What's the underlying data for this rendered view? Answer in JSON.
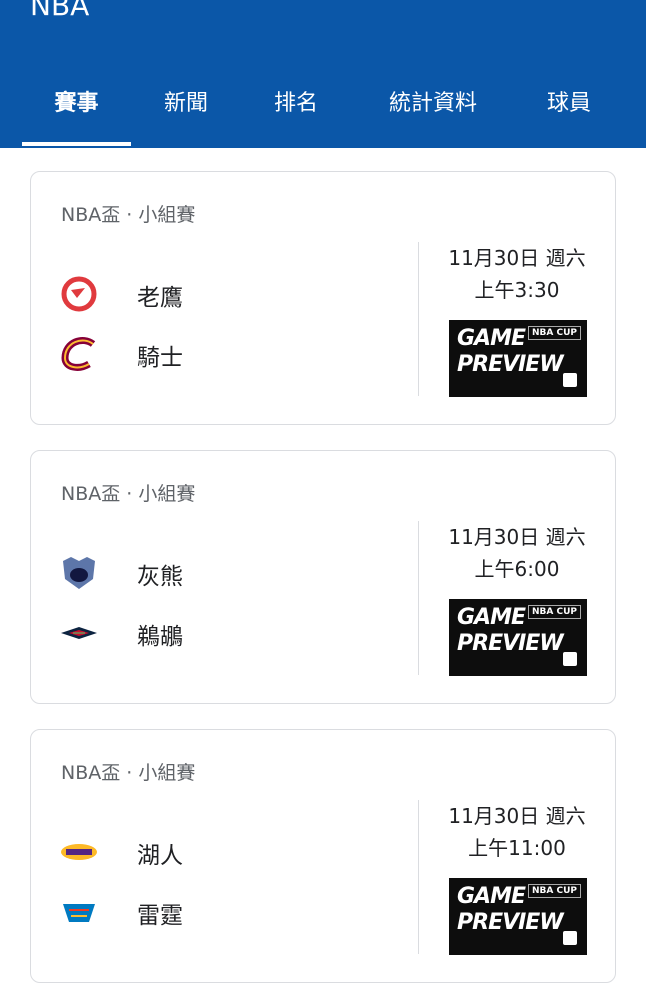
{
  "app": {
    "title": "NBA"
  },
  "tabs": [
    {
      "label": "賽事"
    },
    {
      "label": "新聞"
    },
    {
      "label": "排名"
    },
    {
      "label": "統計資料"
    },
    {
      "label": "球員"
    }
  ],
  "games": [
    {
      "competition": "NBA盃 · 小組賽",
      "teams": [
        {
          "name": "老鷹",
          "logo": "hawks-logo-icon"
        },
        {
          "name": "騎士",
          "logo": "cavaliers-logo-icon"
        }
      ],
      "date": "11月30日 週六",
      "time": "上午3:30",
      "preview": {
        "line1": "GAME",
        "line2": "PREVIEW",
        "badge": "NBA CUP"
      }
    },
    {
      "competition": "NBA盃 · 小組賽",
      "teams": [
        {
          "name": "灰熊",
          "logo": "grizzlies-logo-icon"
        },
        {
          "name": "鵜鶘",
          "logo": "pelicans-logo-icon"
        }
      ],
      "date": "11月30日 週六",
      "time": "上午6:00",
      "preview": {
        "line1": "GAME",
        "line2": "PREVIEW",
        "badge": "NBA CUP"
      }
    },
    {
      "competition": "NBA盃 · 小組賽",
      "teams": [
        {
          "name": "湖人",
          "logo": "lakers-logo-icon"
        },
        {
          "name": "雷霆",
          "logo": "thunder-logo-icon"
        }
      ],
      "date": "11月30日 週六",
      "time": "上午11:00",
      "preview": {
        "line1": "GAME",
        "line2": "PREVIEW",
        "badge": "NBA CUP"
      }
    }
  ],
  "colors": {
    "header": "#0b57a8",
    "hawks": "#e03a3e",
    "cavaliers": "#860038",
    "grizzlies": "#5d76a9",
    "pelicans": "#0c2340",
    "lakers": "#552583",
    "thunder": "#007ac1"
  }
}
